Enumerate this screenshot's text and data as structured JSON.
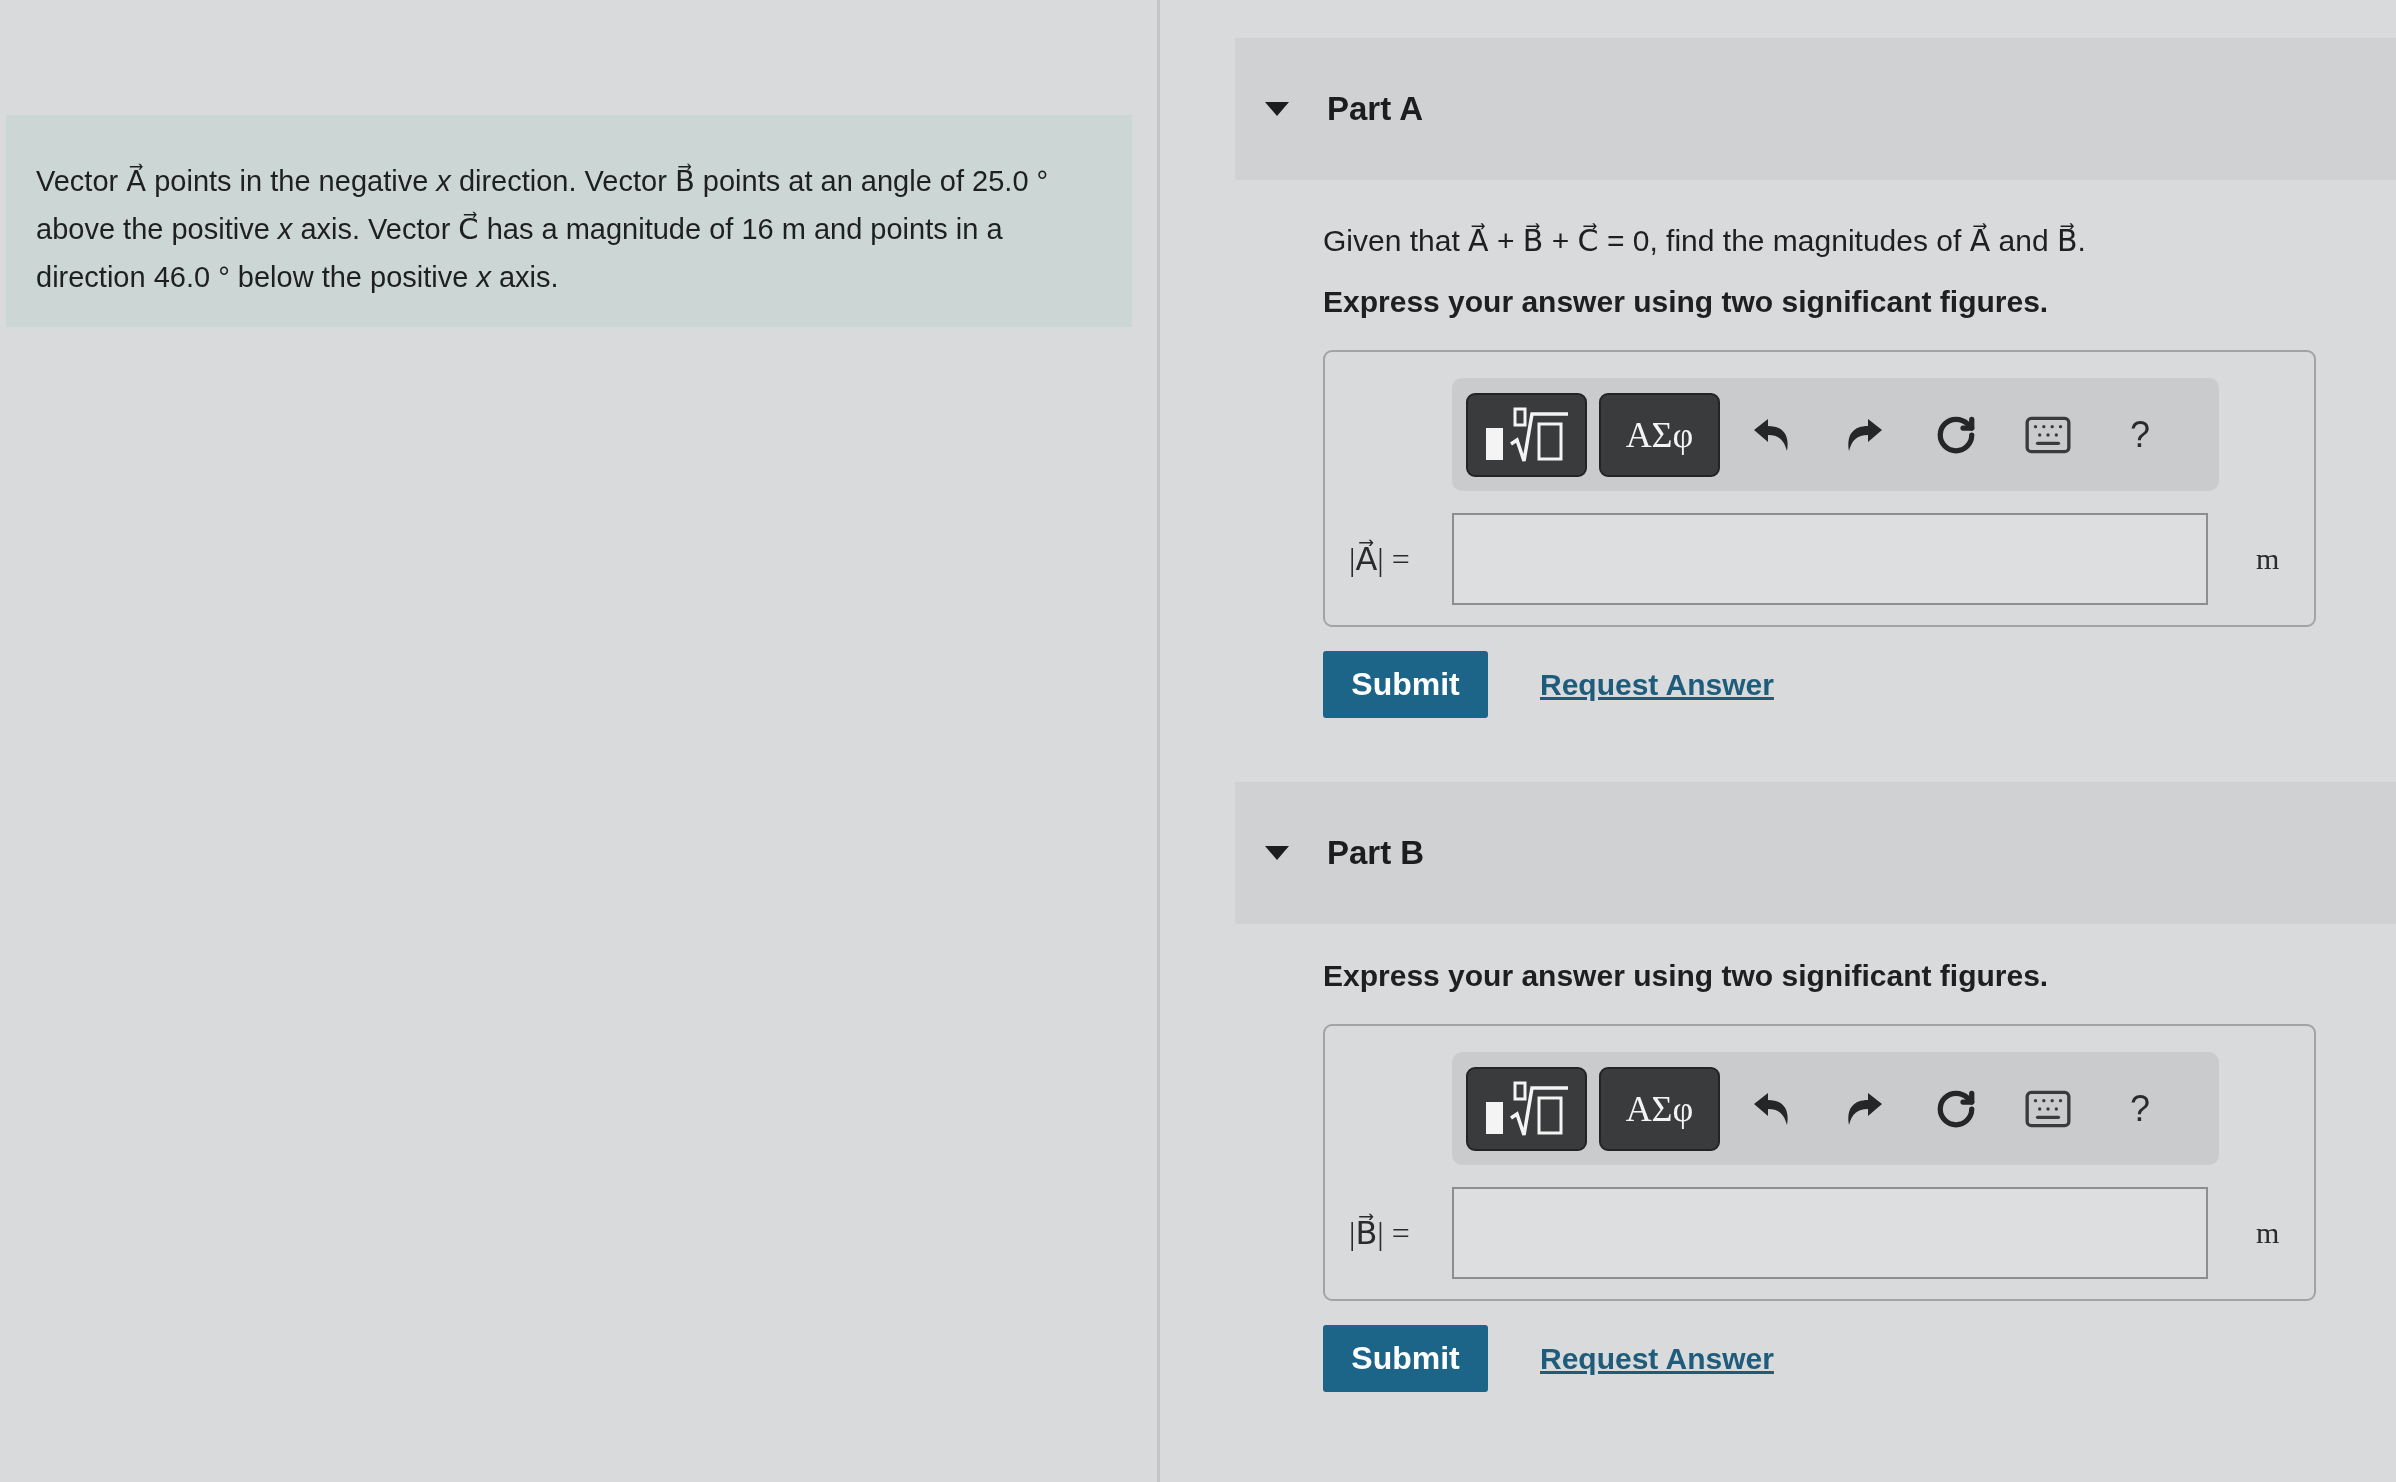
{
  "problem": {
    "text": "Vector A⃗ points in the negative *x* direction. Vector B⃗ points at an angle of 25.0 ° above the positive *x* axis. Vector C⃗ has a magnitude of 16 m and points in a direction 46.0 ° below the positive *x* axis."
  },
  "parts": [
    {
      "title": "Part A",
      "expanded": true,
      "question": "Given that A⃗ + B⃗ + C⃗ = 0, find the magnitudes of A⃗ and B⃗.",
      "instruction": "Express your answer using two significant figures.",
      "toolbar": [
        {
          "kind": "templates"
        },
        {
          "kind": "symbols",
          "label": "ΑΣφ"
        },
        {
          "kind": "undo"
        },
        {
          "kind": "redo"
        },
        {
          "kind": "reset"
        },
        {
          "kind": "keyboard"
        },
        {
          "kind": "help",
          "label": "?"
        }
      ],
      "answer": {
        "label": "|A⃗| =",
        "unit": "m"
      },
      "submit": "Submit",
      "request_answer": "Request Answer"
    },
    {
      "title": "Part B",
      "expanded": true,
      "instruction": "Express your answer using two significant figures.",
      "toolbar": [
        {
          "kind": "templates"
        },
        {
          "kind": "symbols",
          "label": "ΑΣφ"
        },
        {
          "kind": "undo"
        },
        {
          "kind": "redo"
        },
        {
          "kind": "reset"
        },
        {
          "kind": "keyboard"
        },
        {
          "kind": "help",
          "label": "?"
        }
      ],
      "answer": {
        "label": "|B⃗| =",
        "unit": "m"
      },
      "submit": "Submit",
      "request_answer": "Request Answer"
    }
  ]
}
